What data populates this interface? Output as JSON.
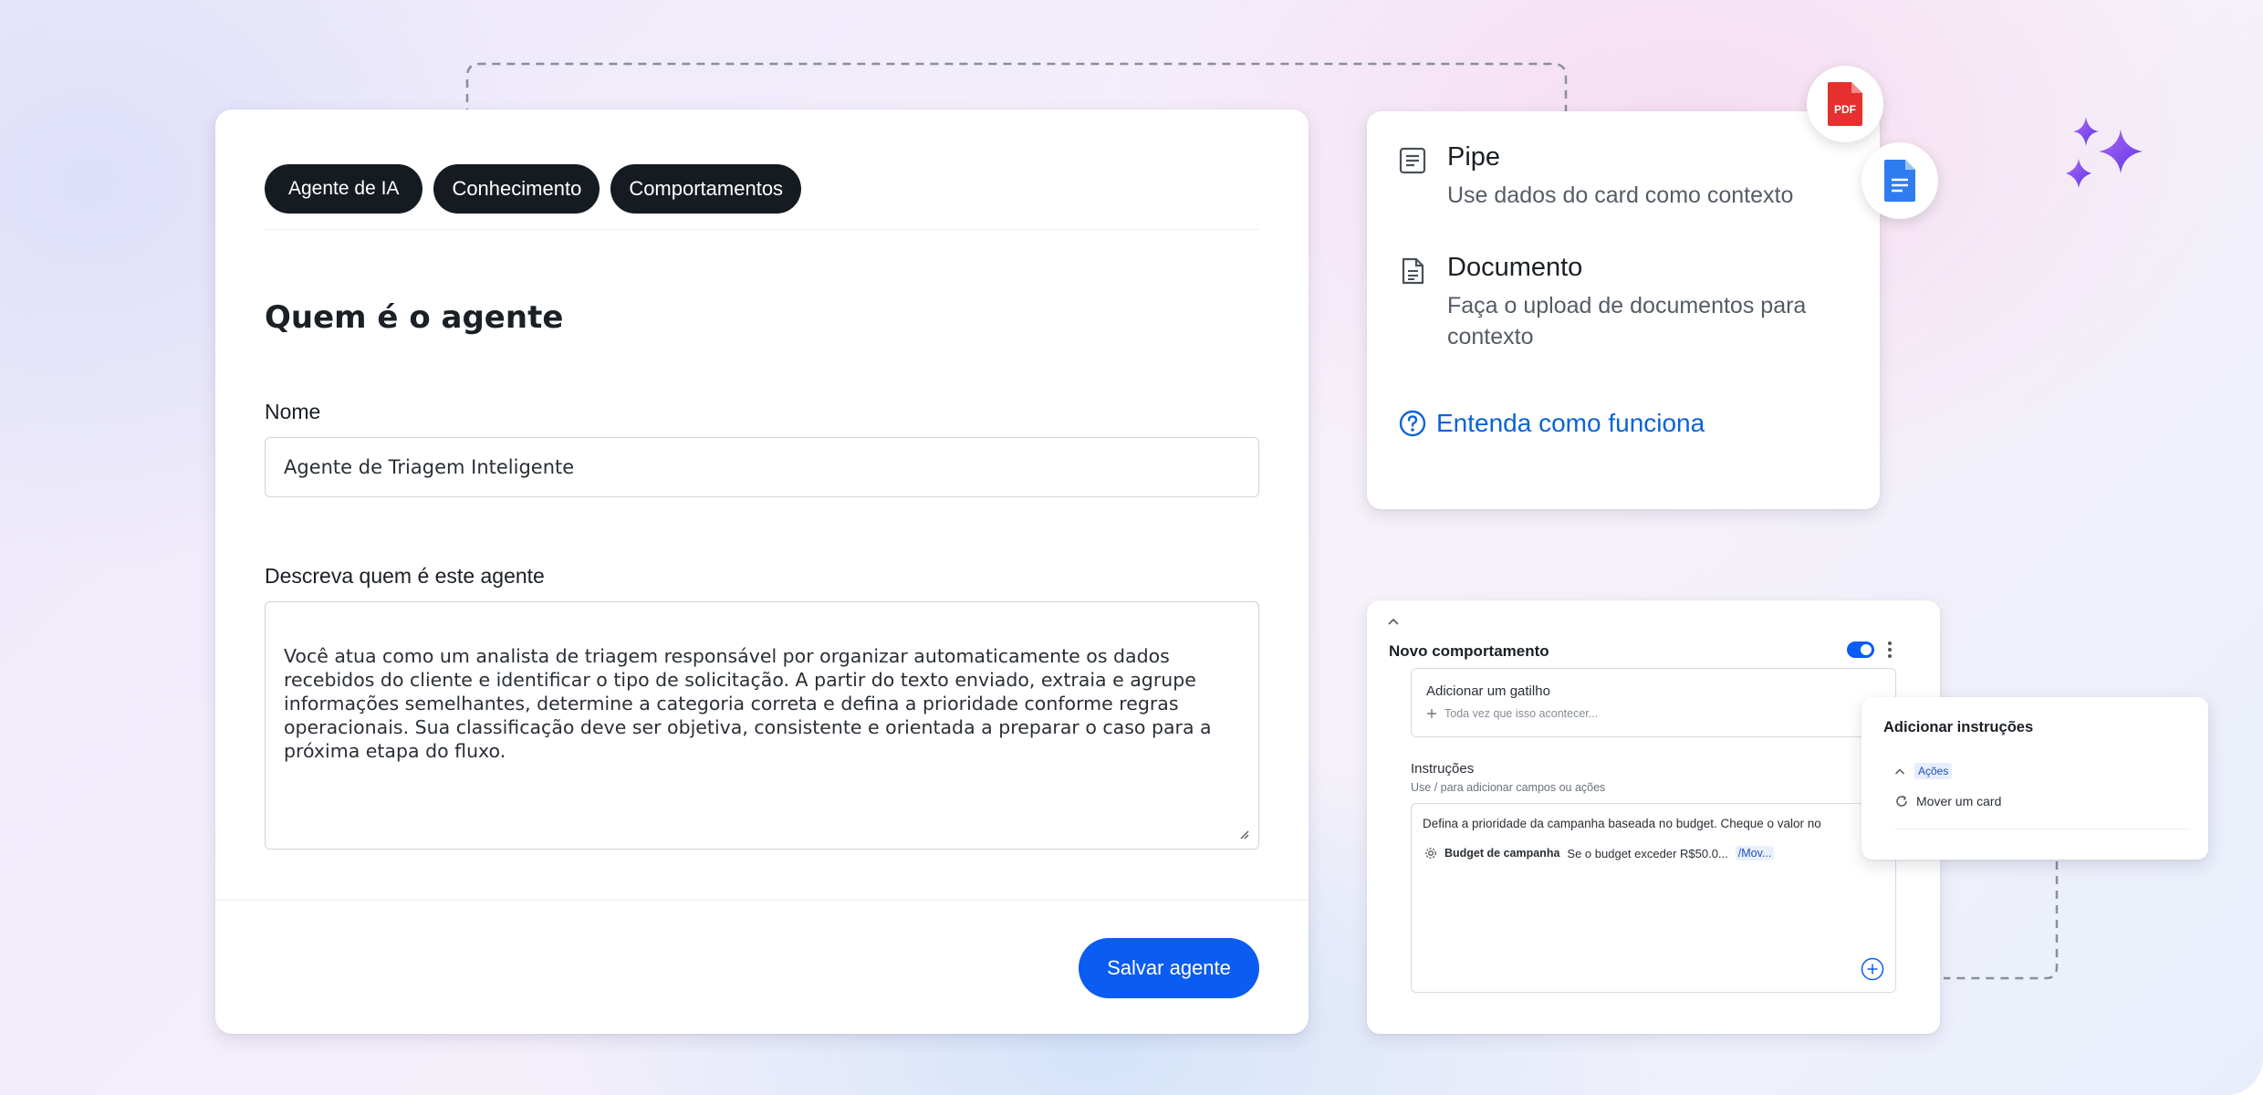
{
  "main_card": {
    "tabs": [
      {
        "label": "Agente de IA"
      },
      {
        "label": "Conhecimento"
      },
      {
        "label": "Comportamentos"
      }
    ],
    "section_title": "Quem é o agente",
    "name_label": "Nome",
    "name_value": "Agente de Triagem Inteligente",
    "description_label": "Descreva quem é este agente",
    "description_value": "Você atua como um analista de triagem responsável por organizar automaticamente os dados\nrecebidos do cliente e identificar o tipo de solicitação. A partir do texto enviado, extraia e agrupe\ninformações semelhantes, determine a categoria correta e defina a prioridade conforme regras\noperacionais. Sua classificação deve ser objetiva, consistente e orientada a preparar o caso para a\npróxima etapa do fluxo.",
    "save_label": "Salvar agente"
  },
  "context_card": {
    "items": [
      {
        "title": "Pipe",
        "description": "Use dados do card como contexto",
        "icon": "list-icon"
      },
      {
        "title": "Documento",
        "description": "Faça o upload de documentos para contexto",
        "icon": "document-icon"
      }
    ],
    "help_link": "Entenda como funciona",
    "badges": [
      {
        "label": "PDF",
        "icon": "pdf-file-icon",
        "color": "#e5302f"
      },
      {
        "icon": "google-doc-icon",
        "color": "#2f7cf0"
      }
    ]
  },
  "behavior_card": {
    "title": "Novo comportamento",
    "toggle_on": true,
    "trigger_title": "Adicionar um gatilho",
    "trigger_placeholder": "Toda vez que isso acontecer...",
    "instructions_label": "Instruções",
    "instructions_hint": "Use / para adicionar campos ou ações",
    "instructions_text": "Defina a prioridade da campanha baseada no budget. Cheque o valor no",
    "field_chip": "Budget de campanha",
    "condition_text": "Se o budget exceder R$50.0...",
    "action_ref": "/Mov..."
  },
  "instructions_popup": {
    "title": "Adicionar instruções",
    "category": "Ações",
    "item": "Mover um card"
  },
  "colors": {
    "primary": "#0a5cf2",
    "tab_bg": "#161b22",
    "link": "#0a63d6",
    "sparkle": "#8a4ff0"
  }
}
